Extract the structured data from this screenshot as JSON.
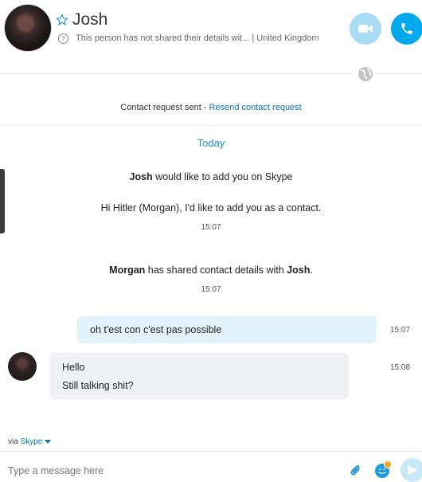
{
  "header": {
    "name": "Josh",
    "subtitle": "This person has not shared their details wit...  |  United Kingdom"
  },
  "contact_request": {
    "status": "Contact request sent - ",
    "link": "Resend contact request"
  },
  "conversation": {
    "date_label": "Today",
    "sys1": {
      "bold": "Josh",
      "rest": " would like to add you on Skype"
    },
    "sys2": "Hi Hitler (Morgan), I'd like to add you as a contact.",
    "time1": "15:07",
    "sys3": {
      "bold1": "Morgan",
      "mid": " has shared contact details with ",
      "bold2": "Josh",
      "end": "."
    },
    "time2": "15:07",
    "outgoing": {
      "text": "oh t'est con c'est pas possible",
      "time": "15:07"
    },
    "incoming": {
      "line1": "Hello",
      "line2": "Still talking shit?",
      "time": "15:08"
    }
  },
  "composer": {
    "via_label": "via ",
    "via_service": "Skype",
    "placeholder": "Type a message here"
  },
  "icons": {
    "video": "video-camera-icon",
    "call": "phone-icon",
    "globe": "globe-icon",
    "attach": "paperclip-icon",
    "emoji": "emoji-icon",
    "send": "send-icon"
  },
  "colors": {
    "accent": "#00a8ec",
    "link": "#0a76b7",
    "outgoing_bubble": "#e3f3fb",
    "incoming_bubble": "#eef0f3"
  }
}
